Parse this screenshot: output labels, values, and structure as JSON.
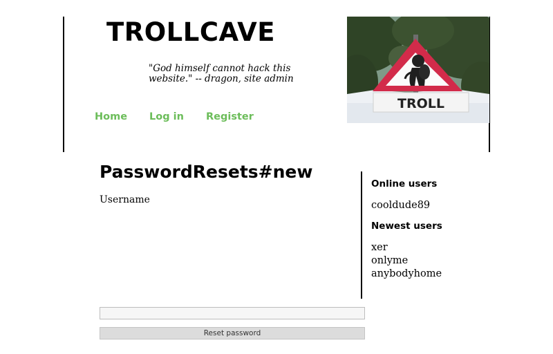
{
  "header": {
    "site_title": "TROLLCAVE",
    "tagline": "\"God himself cannot hack this website.\" -- dragon, site admin",
    "hero_sign_text": "TROLL"
  },
  "nav": {
    "items": [
      {
        "label": "Home"
      },
      {
        "label": "Log in"
      },
      {
        "label": "Register"
      }
    ],
    "link_color": "#6cbd5a"
  },
  "main": {
    "heading": "PasswordResets#new",
    "username_label": "Username",
    "username_value": "",
    "reset_button_label": "Reset password"
  },
  "sidebar": {
    "online_heading": "Online users",
    "online_users": [
      "cooldude89"
    ],
    "newest_heading": "Newest users",
    "newest_users": [
      "xer",
      "onlyme",
      "anybodyhome"
    ]
  }
}
